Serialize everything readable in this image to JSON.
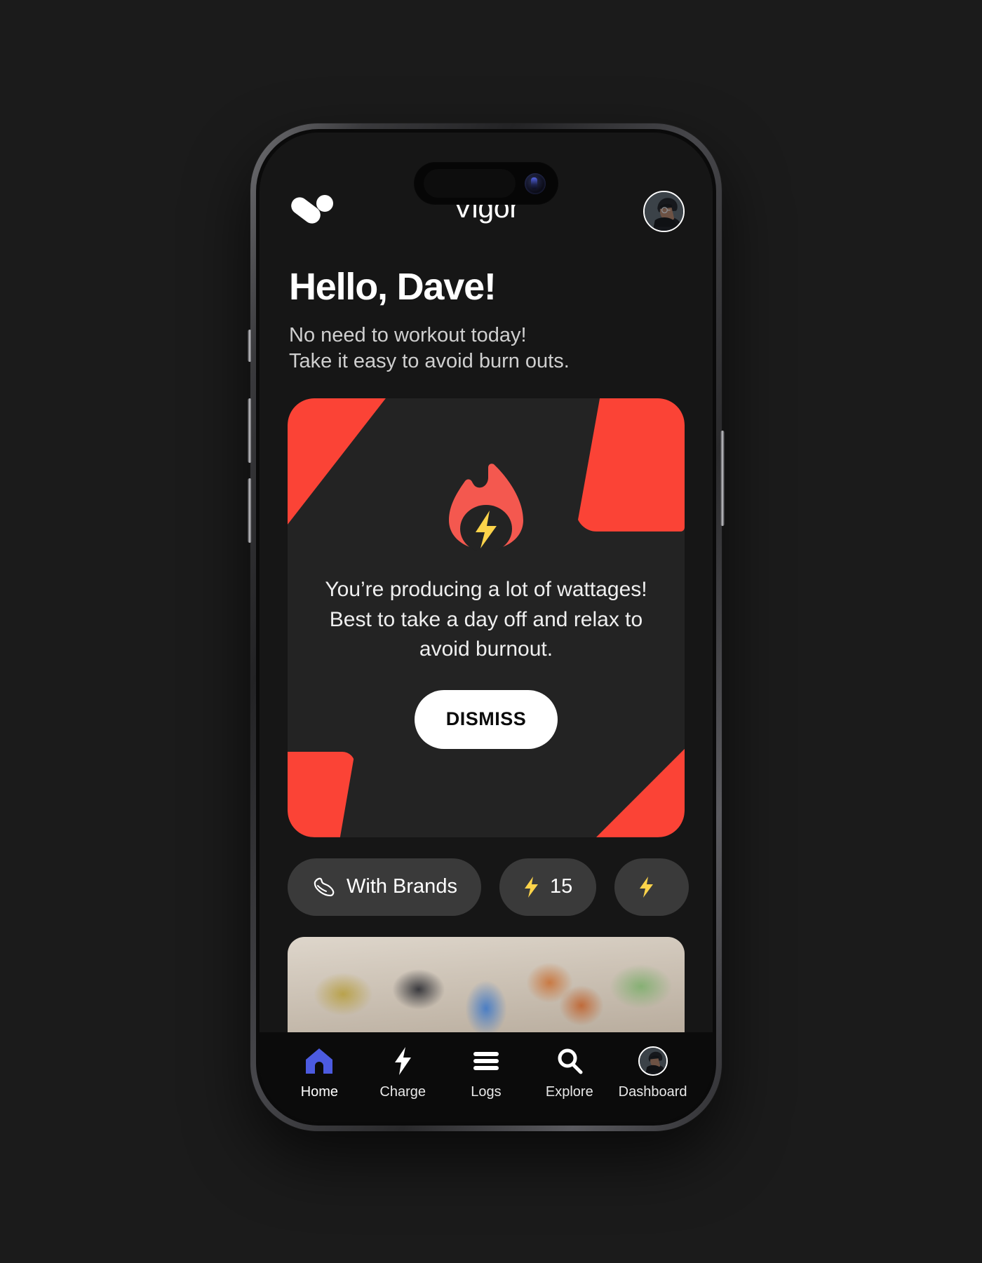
{
  "app": {
    "title": "Vigor",
    "logo_icon": "vigor-logo-icon",
    "avatar_icon": "user-avatar"
  },
  "greeting": {
    "title": "Hello, Dave!",
    "subtitle_line1": "No need to workout today!",
    "subtitle_line2": "Take it easy to avoid burn outs."
  },
  "alert_card": {
    "icon": "flame-bolt-icon",
    "message": "You’re producing a lot of wattages! Best to take a day off and relax to avoid burnout.",
    "dismiss_label": "DISMISS",
    "accent_color": "#FB4336",
    "card_background": "#232323"
  },
  "chips": [
    {
      "icon": "shoe-icon",
      "label": "With Brands",
      "value": ""
    },
    {
      "icon": "lightning-icon",
      "label": "15",
      "value": "15"
    },
    {
      "icon": "lightning-icon",
      "label": "",
      "value": ""
    }
  ],
  "photo_strip": {
    "alt": "climbing-wall-photo"
  },
  "bottom_nav": {
    "active": "Home",
    "items": [
      {
        "icon": "home-icon",
        "label": "Home",
        "active": true
      },
      {
        "icon": "bolt-icon",
        "label": "Charge",
        "active": false
      },
      {
        "icon": "menu-lines-icon",
        "label": "Logs",
        "active": false
      },
      {
        "icon": "search-icon",
        "label": "Explore",
        "active": false
      },
      {
        "icon": "avatar-icon",
        "label": "Dashboard",
        "active": false
      }
    ]
  },
  "colors": {
    "screen_background": "#161616",
    "nav_background": "#0B0B0B",
    "accent_red": "#FB4336",
    "accent_yellow": "#FCD34A",
    "home_blue": "#4C5BE0",
    "chip_background": "#3A3A3A"
  }
}
